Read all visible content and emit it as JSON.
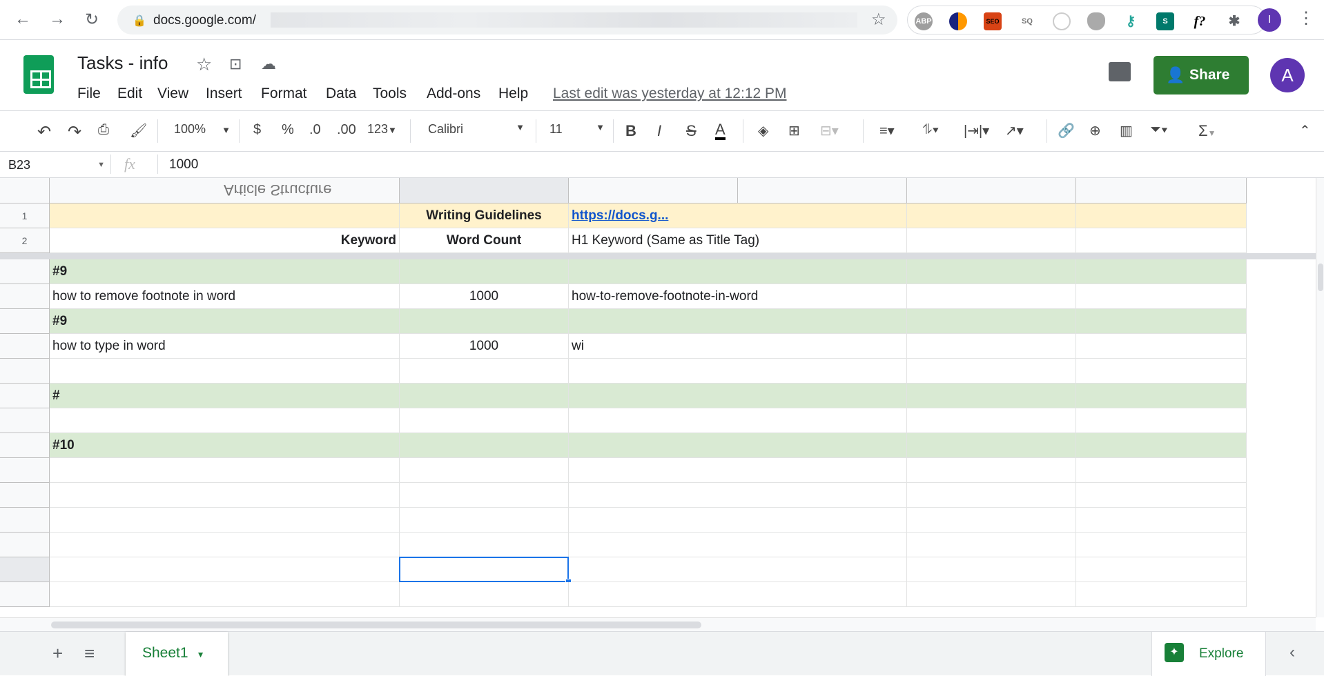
{
  "browser": {
    "url": "docs.google.com/",
    "extensions": [
      "abp-icon",
      "sync-icon",
      "seo-icon",
      "sq-icon",
      "shield-outline-icon",
      "shield-gray-icon",
      "key-icon",
      "s-app-icon",
      "f-question-icon",
      "puzzle-icon"
    ],
    "ext_labels": {
      "abp": "ABP",
      "seo": "SEO",
      "sq": "SQ",
      "f": "f?"
    },
    "profile_initial": "I"
  },
  "doc": {
    "title": "Tasks - info",
    "last_edit": "Last edit was yesterday at 12:12 PM",
    "share_label": "Share",
    "avatar_initial": "A"
  },
  "menu": [
    "File",
    "Edit",
    "View",
    "Insert",
    "Format",
    "Data",
    "Tools",
    "Add-ons",
    "Help"
  ],
  "toolbar": {
    "zoom": "100%",
    "currency": "$",
    "percent": "%",
    "dec_less": ".0",
    "dec_more": ".00",
    "format_more": "123",
    "font": "Calibri",
    "font_size": "11",
    "bold": "B",
    "italic": "I",
    "strike": "S",
    "text_color": "A",
    "sum": "Σ"
  },
  "formula_bar": {
    "cell_ref": "B23",
    "fx": "fx",
    "value": "1000"
  },
  "frozen_header_text": "Article Structure",
  "rows": [
    {
      "num": "1",
      "a": "",
      "b": "Writing Guidelines",
      "c": "https://docs.g...",
      "fill": "#fff2cc"
    },
    {
      "num": "2",
      "a": "Keyword",
      "b": "Word Count",
      "c": "H1 Keyword (Same as Title Tag)",
      "fill": "#ffffff"
    },
    {
      "num": "",
      "a": "#9",
      "b": "",
      "c": "",
      "fill": "#d9ead3"
    },
    {
      "num": "",
      "a": "how to remove footnote in word",
      "b": "1000",
      "c": "how-to-remove-footnote-in-word",
      "fill": "#ffffff"
    },
    {
      "num": "",
      "a": "#9",
      "b": "",
      "c": "",
      "fill": "#d9ead3"
    },
    {
      "num": "",
      "a": "how to type in word",
      "b": "1000",
      "c": "wi",
      "fill": "#ffffff"
    },
    {
      "num": "",
      "a": "",
      "b": "",
      "c": "",
      "fill": "#ffffff"
    },
    {
      "num": "",
      "a": "#",
      "b": "",
      "c": "",
      "fill": "#d9ead3"
    },
    {
      "num": "",
      "a": "",
      "b": "",
      "c": "",
      "fill": "#ffffff"
    },
    {
      "num": "",
      "a": "#10",
      "b": "",
      "c": "",
      "fill": "#d9ead3"
    },
    {
      "num": "",
      "a": "",
      "b": "",
      "c": "",
      "fill": "#ffffff"
    },
    {
      "num": "",
      "a": "",
      "b": "",
      "c": "",
      "fill": "#ffffff"
    },
    {
      "num": "",
      "a": "",
      "b": "",
      "c": "",
      "fill": "#ffffff"
    },
    {
      "num": "",
      "a": "",
      "b": "",
      "c": "",
      "fill": "#ffffff"
    },
    {
      "num": "",
      "a": "",
      "b": "",
      "c": "",
      "fill": "#ffffff"
    },
    {
      "num": "",
      "a": "",
      "b": "",
      "c": "",
      "fill": "#ffffff"
    }
  ],
  "sheets": {
    "add": "+",
    "list": "≡",
    "active": "Sheet1",
    "explore": "Explore"
  },
  "colors": {
    "accent": "#188038",
    "selection": "#1a73e8",
    "share": "#2e7d32",
    "avatar": "#5e35b1"
  }
}
